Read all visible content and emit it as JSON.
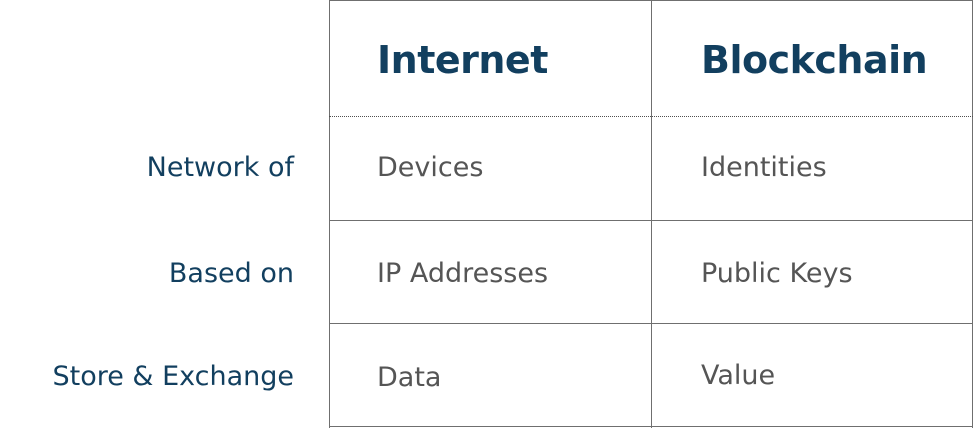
{
  "table": {
    "columns": [
      "Internet",
      "Blockchain"
    ],
    "rows": [
      {
        "label": "Network of",
        "values": [
          "Devices",
          "Identities"
        ]
      },
      {
        "label": "Based on",
        "values": [
          "IP Addresses",
          "Public Keys"
        ]
      },
      {
        "label": "Store & Exchange",
        "values": [
          "Data",
          "Value"
        ]
      }
    ]
  },
  "colors": {
    "heading": "#123f5f",
    "cell_text": "#555555",
    "grid": "#6f6f6f"
  }
}
